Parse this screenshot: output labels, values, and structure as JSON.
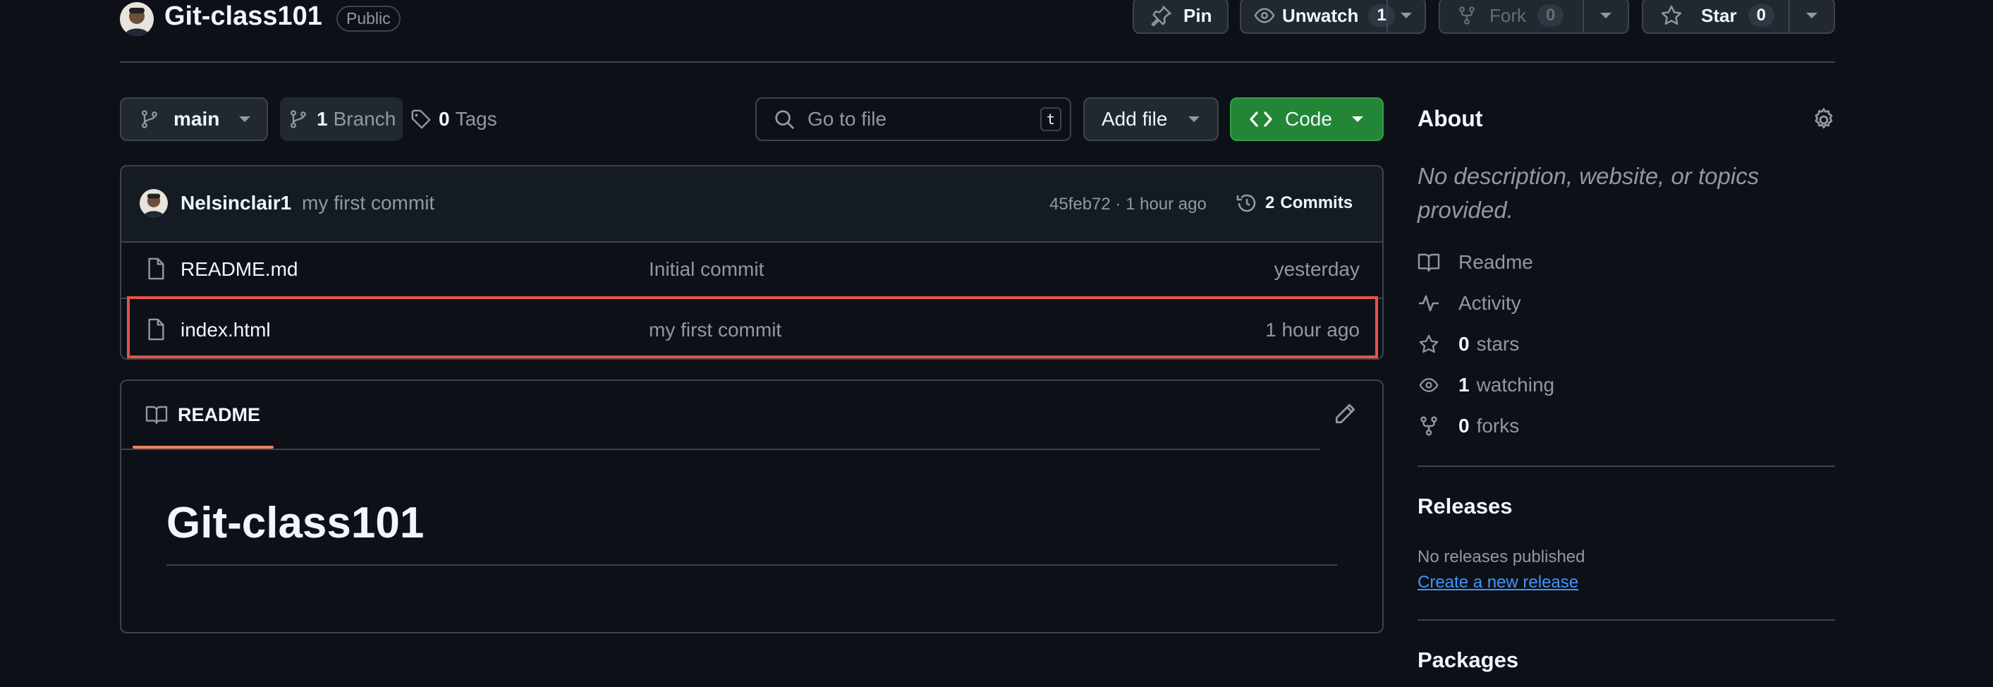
{
  "repo": {
    "name": "Git-class101",
    "visibility": "Public"
  },
  "actions": {
    "pin_label": "Pin",
    "unwatch_label": "Unwatch",
    "unwatch_count": "1",
    "fork_label": "Fork",
    "fork_count": "0",
    "star_label": "Star",
    "star_count": "0"
  },
  "toolbar": {
    "branch": "main",
    "branches_count": "1",
    "branches_label": "Branch",
    "tags_count": "0",
    "tags_label": "Tags",
    "search_placeholder": "Go to file",
    "search_shortcut": "t",
    "add_file_label": "Add file",
    "code_label": "Code"
  },
  "latest_commit": {
    "author": "Nelsinclair1",
    "message": "my first commit",
    "meta": "45feb72 · 1 hour ago",
    "commits_count": "2",
    "commits_label": "Commits"
  },
  "files": [
    {
      "name": "README.md",
      "message": "Initial commit",
      "time": "yesterday"
    },
    {
      "name": "index.html",
      "message": "my first commit",
      "time": "1 hour ago"
    }
  ],
  "readme": {
    "tab_label": "README",
    "heading": "Git-class101"
  },
  "about": {
    "title": "About",
    "description": "No description, website, or topics provided.",
    "readme": "Readme",
    "activity": "Activity",
    "stars_count": "0",
    "stars_label": "stars",
    "watching_count": "1",
    "watching_label": "watching",
    "forks_count": "0",
    "forks_label": "forks"
  },
  "releases": {
    "title": "Releases",
    "none": "No releases published",
    "create_link": "Create a new release"
  },
  "packages": {
    "title": "Packages"
  },
  "colors": {
    "bg": "#0d1117",
    "border": "#3d444d",
    "green": "#238636",
    "link": "#4493f8",
    "highlight": "#e5534b"
  }
}
